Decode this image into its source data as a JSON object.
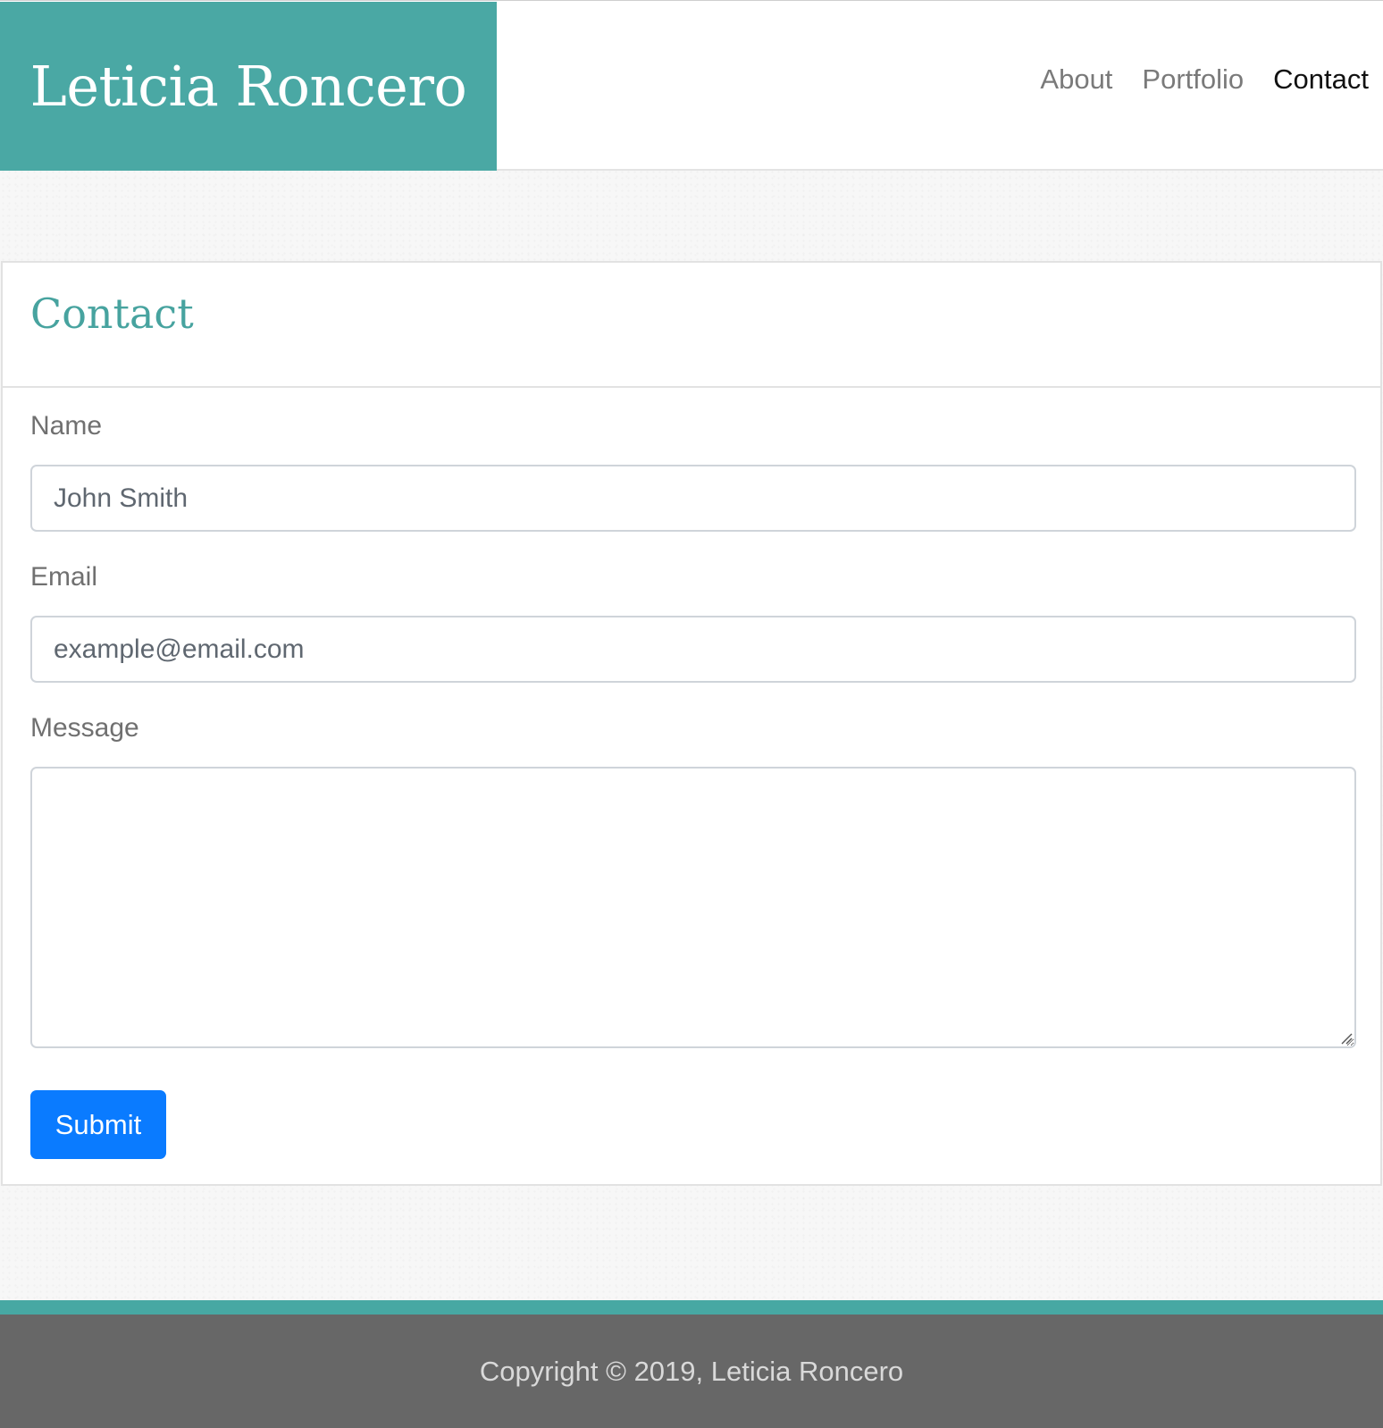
{
  "header": {
    "brand": "Leticia Roncero",
    "brand_color": "#4aa8a4",
    "nav": {
      "about": "About",
      "portfolio": "Portfolio",
      "contact": "Contact"
    },
    "active_nav": "Contact"
  },
  "contact": {
    "title": "Contact",
    "name_label": "Name",
    "name_placeholder": "John Smith",
    "email_label": "Email",
    "email_placeholder": "example@email.com",
    "message_label": "Message",
    "message_value": "",
    "submit_label": "Submit"
  },
  "footer": {
    "copyright": "Copyright © 2019, Leticia Roncero",
    "stripe_color": "#47a8a3"
  },
  "colors": {
    "accent": "#47a39f",
    "submit": "#0a7bff",
    "footer_bg": "#676767"
  }
}
